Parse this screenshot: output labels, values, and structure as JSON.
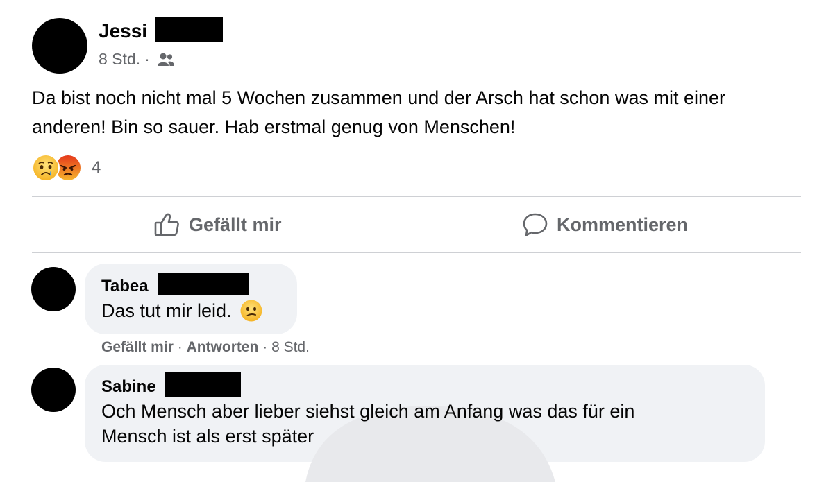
{
  "post": {
    "author": "Jessi",
    "time": "8 Std.",
    "separator": "·",
    "audience_icon": "friends-icon",
    "text": "Da bist noch nicht mal 5 Wochen zusammen und der Arsch hat schon was mit einer anderen! Bin so sauer. Hab erstmal genug von Menschen!",
    "reactions": {
      "icons": [
        "sad-reaction-icon",
        "angry-reaction-icon"
      ],
      "count": "4"
    }
  },
  "actions": {
    "like_label": "Gefällt mir",
    "comment_label": "Kommentieren"
  },
  "comments": [
    {
      "author": "Tabea",
      "text": "Das tut mir leid.",
      "emoji": "confused-face-icon",
      "like_label": "Gefällt mir",
      "reply_label": "Antworten",
      "separator": "·",
      "time": "8 Std."
    },
    {
      "author": "Sabine",
      "text_line1": "Och Mensch aber lieber siehst gleich am Anfang was das für ein",
      "text_line2": "Mensch ist als erst später"
    }
  ],
  "colors": {
    "text": "#050505",
    "secondary": "#65676b",
    "bubble": "#f0f2f5",
    "divider": "#ced0d4"
  }
}
